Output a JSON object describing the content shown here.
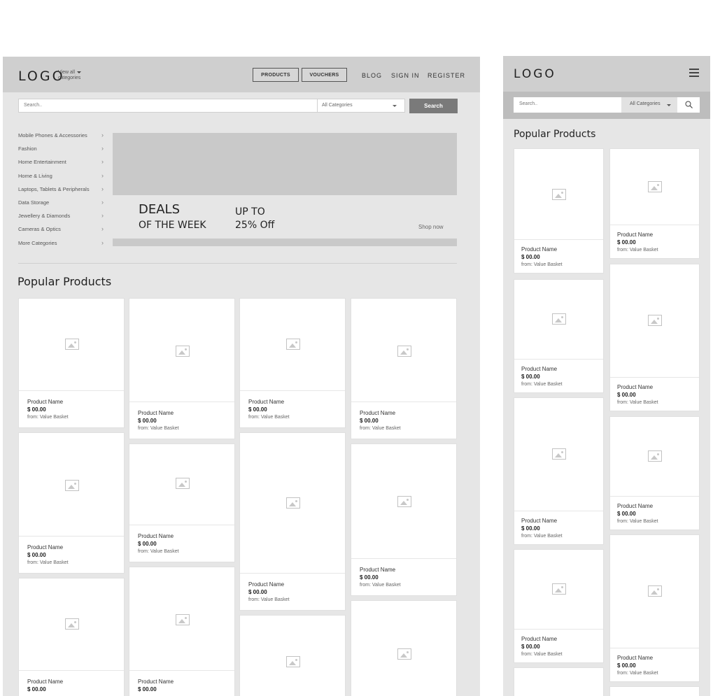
{
  "desktop": {
    "logo": "LOGO",
    "view_all_line1": "View all",
    "view_all_line2": "categories",
    "buttons": [
      {
        "label": "PRODUCTS"
      },
      {
        "label": "VOUCHERS"
      }
    ],
    "links": [
      {
        "label": "BLOG"
      },
      {
        "label": "SIGN IN"
      },
      {
        "label": "REGISTER"
      }
    ],
    "search": {
      "placeholder": "Search..",
      "category": "All Categories",
      "button": "Search"
    },
    "categories": [
      "Mobile Phones & Accessories",
      "Fashion",
      "Home Entertainment",
      "Home & Living",
      "Laptops, Tablets & Peripherals",
      "Data Storage",
      "Jewellery & Diamonds",
      "Cameras & Optics",
      "More Categories"
    ],
    "chevron": "›",
    "hero": {
      "deals_line1": "DEALS",
      "deals_line2": "OF THE WEEK",
      "upto_line1": "UP TO",
      "upto_line2": "25% Off",
      "shop_now": "Shop now"
    },
    "popular_title": "Popular Products"
  },
  "mobile": {
    "logo": "LOGO",
    "search": {
      "placeholder": "Search..",
      "category": "All Categories"
    },
    "popular_title": "Popular Products"
  },
  "product": {
    "name": "Product Name",
    "price": "$ 00.00",
    "from": "from: Value Basket"
  }
}
